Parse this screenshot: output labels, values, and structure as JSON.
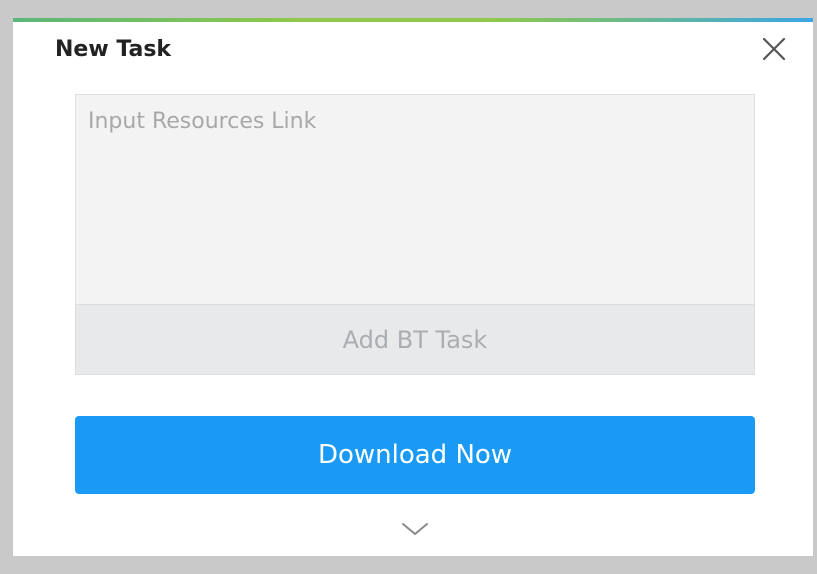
{
  "dialog": {
    "title": "New Task",
    "close_icon": "close-icon",
    "link_input": {
      "placeholder": "Input Resources Link",
      "value": ""
    },
    "bt_task_label": "Add BT Task",
    "download_label": "Download Now",
    "expand_icon": "chevron-down-icon"
  },
  "colors": {
    "primary": "#1a9af5",
    "input_bg": "#f3f3f3",
    "bt_button_bg": "#e8e9ea",
    "bt_button_text": "#a9aeb3",
    "title_text": "#222222"
  }
}
